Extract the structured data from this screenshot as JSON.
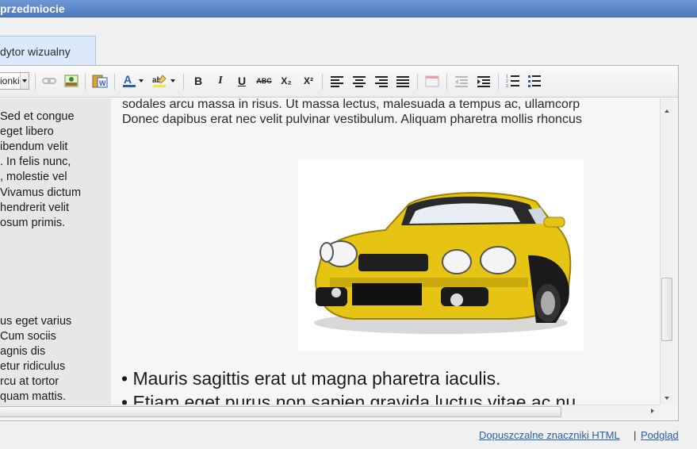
{
  "header": {
    "title": "przedmiocie"
  },
  "tab": {
    "label": "dytor wizualny"
  },
  "toolbar": {
    "font_select_value": "ionki",
    "buttons": [
      {
        "name": "link-icon"
      },
      {
        "name": "image-icon"
      },
      {
        "name": "paste-from-word-icon"
      },
      {
        "name": "text-color-icon"
      },
      {
        "name": "highlight-color-icon"
      },
      {
        "name": "bold-icon",
        "glyph": "B"
      },
      {
        "name": "italic-icon",
        "glyph": "I"
      },
      {
        "name": "underline-icon",
        "glyph": "U"
      },
      {
        "name": "strikethrough-icon",
        "glyph": "ABC"
      },
      {
        "name": "subscript-icon",
        "glyph": "X₂"
      },
      {
        "name": "superscript-icon",
        "glyph": "X²"
      },
      {
        "name": "align-left-icon"
      },
      {
        "name": "align-center-icon"
      },
      {
        "name": "align-right-icon"
      },
      {
        "name": "align-justify-icon"
      },
      {
        "name": "table-icon"
      },
      {
        "name": "outdent-icon"
      },
      {
        "name": "indent-icon"
      },
      {
        "name": "ordered-list-icon"
      },
      {
        "name": "unordered-list-icon"
      }
    ],
    "colors": {
      "text_color": "#2e5bb5",
      "highlight_color": "#f2e24b"
    }
  },
  "sidebar": {
    "lines_top": [
      "Sed et congue",
      "eget libero",
      "ibendum velit",
      ". In felis nunc,",
      ", molestie vel",
      " Vivamus dictum",
      "hendrerit velit",
      "osum primis."
    ],
    "lines_bottom": [
      "us eget varius",
      "Cum sociis",
      "agnis dis",
      "etur ridiculus",
      "rcu at tortor",
      "quam mattis."
    ]
  },
  "content": {
    "line1": "sodales arcu massa in risus. Ut massa lectus, malesuada a tempus ac, ullamcorp",
    "line2": "Donec dapibus erat nec velit pulvinar vestibulum. Aliquam pharetra mollis rhoncus",
    "image_alt": "yellow sports car",
    "bullets": [
      "Mauris sagittis erat ut magna pharetra iaculis.",
      "Etiam eget purus non sapien gravida luctus vitae ac nu"
    ]
  },
  "footer": {
    "allowed_html_link": "Dopuszczalne znaczniki HTML",
    "separator": "|",
    "preview_link": "Podgląd"
  }
}
